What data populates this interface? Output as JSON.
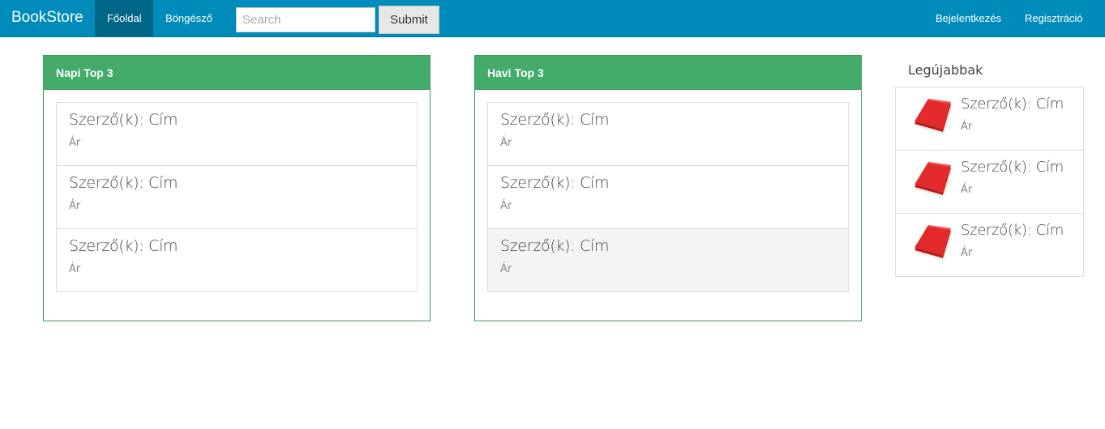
{
  "navbar": {
    "brand": "BookStore",
    "links": [
      {
        "label": "Főoldal",
        "active": true
      },
      {
        "label": "Böngésző",
        "active": false
      }
    ],
    "search": {
      "placeholder": "Search",
      "value": ""
    },
    "submit_label": "Submit",
    "right_links": [
      {
        "label": "Bejelentkezés"
      },
      {
        "label": "Regisztráció"
      }
    ]
  },
  "colors": {
    "navbar": "#008cba",
    "navbar_active": "#006687",
    "panel_heading": "#43ac6a",
    "panel_border": "#3c9a5f",
    "book_icon": "#e32b2b"
  },
  "daily_top": {
    "heading": "Napi Top 3",
    "items": [
      {
        "title": "Szerző(k): Cím",
        "price": "Ár"
      },
      {
        "title": "Szerző(k): Cím",
        "price": "Ár"
      },
      {
        "title": "Szerző(k): Cím",
        "price": "Ár"
      }
    ]
  },
  "monthly_top": {
    "heading": "Havi Top 3",
    "items": [
      {
        "title": "Szerző(k): Cím",
        "price": "Ár"
      },
      {
        "title": "Szerző(k): Cím",
        "price": "Ár"
      },
      {
        "title": "Szerző(k): Cím",
        "price": "Ár",
        "hovered": true
      }
    ]
  },
  "newest": {
    "heading": "Legújabbak",
    "items": [
      {
        "icon": "red-book-icon",
        "title": "Szerző(k): Cím",
        "price": "Ár"
      },
      {
        "icon": "red-book-icon",
        "title": "Szerző(k): Cím",
        "price": "Ár"
      },
      {
        "icon": "red-book-icon",
        "title": "Szerző(k): Cím",
        "price": "Ár"
      }
    ]
  }
}
